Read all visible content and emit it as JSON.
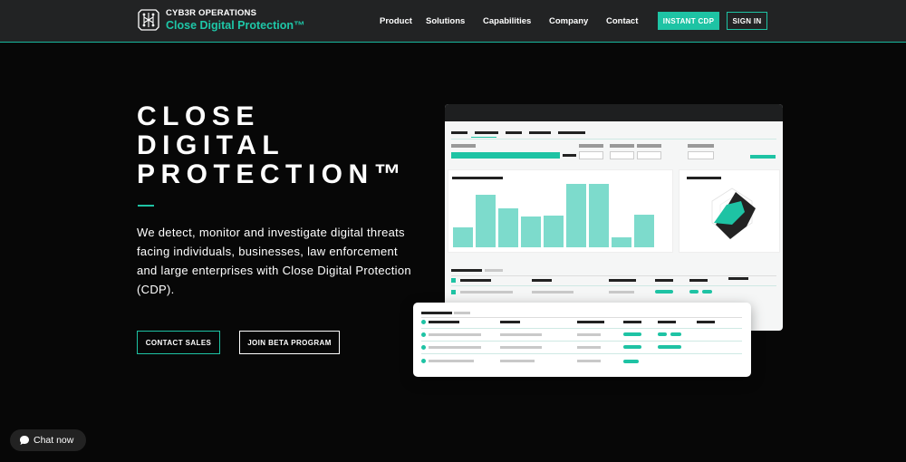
{
  "header": {
    "brand_name": "CYB3R OPERATIONS",
    "brand_tagline": "Close Digital Protection™",
    "nav": [
      "Product",
      "Solutions",
      "Capabilities",
      "Company",
      "Contact"
    ],
    "instant_cdp": "INSTANT CDP",
    "sign_in": "SIGN IN"
  },
  "hero": {
    "title_lines": [
      "CLOSE",
      "DIGITAL",
      "PROTECTION™"
    ],
    "description": "We detect, monitor and investigate digital threats facing individuals, businesses, law enforcement and large enterprises with Close Digital Protection (CDP).",
    "contact_sales": "CONTACT SALES",
    "join_beta": "JOIN BETA PROGRAM"
  },
  "dashboard": {
    "chart_bars": [
      0.32,
      0.83,
      0.61,
      0.49,
      0.5,
      1.0,
      1.0,
      0.16,
      0.52
    ]
  },
  "chat": {
    "label": "Chat now"
  },
  "colors": {
    "accent": "#1ec3a4",
    "header_bg": "#222324",
    "page_bg": "#070707"
  },
  "icons": {
    "logo": "circuit-logo-icon",
    "chat": "chat-bubble-icon"
  }
}
